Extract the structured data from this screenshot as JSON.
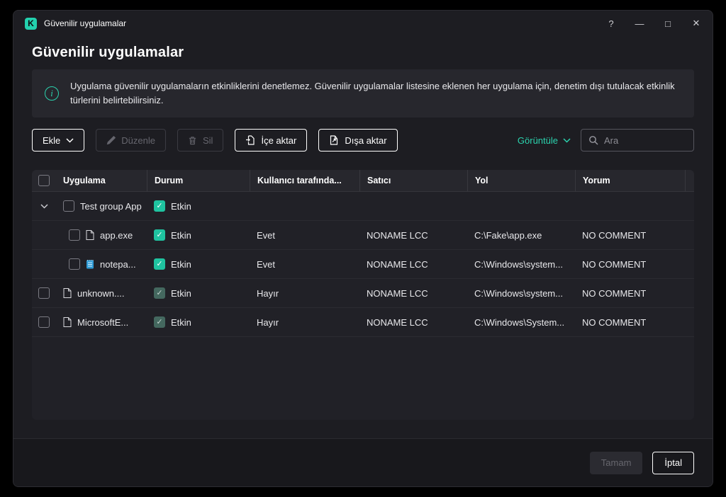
{
  "titlebar": {
    "title": "Güvenilir uygulamalar",
    "help": "?",
    "minimize": "—",
    "maximize": "□",
    "close": "✕"
  },
  "page": {
    "title": "Güvenilir uygulamalar",
    "info_text": "Uygulama güvenilir uygulamaların etkinliklerini denetlemez. Güvenilir uygulamalar listesine eklenen her uygulama için, denetim dışı tutulacak etkinlik türlerini belirtebilirsiniz."
  },
  "toolbar": {
    "add": "Ekle",
    "edit": "Düzenle",
    "delete": "Sil",
    "import": "İçe aktar",
    "export": "Dışa aktar",
    "view": "Görüntüle",
    "search_placeholder": "Ara"
  },
  "table": {
    "columns": {
      "app": "Uygulama",
      "status": "Durum",
      "user": "Kullanıcı tarafında...",
      "vendor": "Satıcı",
      "path": "Yol",
      "comment": "Yorum"
    },
    "group": {
      "name": "Test group App",
      "status": "Etkin"
    },
    "rows": [
      {
        "name": "app.exe",
        "status": "Etkin",
        "user": "Evet",
        "vendor": "NONAME LCC",
        "path": "C:\\Fake\\app.exe",
        "comment": "NO COMMENT"
      },
      {
        "name": "notepa...",
        "status": "Etkin",
        "user": "Evet",
        "vendor": "NONAME LCC",
        "path": "C:\\Windows\\system...",
        "comment": "NO COMMENT"
      },
      {
        "name": "unknown....",
        "status": "Etkin",
        "user": "Hayır",
        "vendor": "NONAME LCC",
        "path": "C:\\Windows\\system...",
        "comment": "NO COMMENT"
      },
      {
        "name": "MicrosoftE...",
        "status": "Etkin",
        "user": "Hayır",
        "vendor": "NONAME LCC",
        "path": "C:\\Windows\\System...",
        "comment": "NO COMMENT"
      }
    ]
  },
  "footer": {
    "ok": "Tamam",
    "cancel": "İptal"
  },
  "colors": {
    "accent": "#2bd3ae",
    "checkbox_checked": "#1fc3a0",
    "checkbox_muted": "#44685f"
  }
}
